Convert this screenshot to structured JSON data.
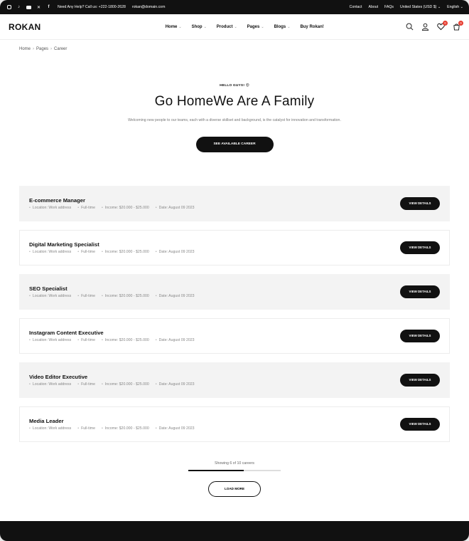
{
  "topbar": {
    "social": [
      "instagram-icon",
      "tiktok-icon",
      "youtube-icon",
      "x-icon",
      "facebook-icon"
    ],
    "help": "Need Any Help? Call us: +222-1800-2628",
    "email": "rokan@domain.com",
    "links": [
      "Contact",
      "About",
      "FAQs"
    ],
    "currency": "United States (USD $)",
    "language": "English"
  },
  "header": {
    "logo": "ROKAN",
    "nav": [
      "Home",
      "Shop",
      "Product",
      "Pages",
      "Blogs",
      "Buy Rokan!"
    ],
    "wishlist_count": "0",
    "cart_count": "0"
  },
  "breadcrumb": [
    "Home",
    "Pages",
    "Career"
  ],
  "hero": {
    "eyebrow": "HELLO GUYS! 😍",
    "title": "Go HomeWe Are A Family",
    "subtitle": "Welcoming new people to our teams, each with a diverse skillset and background, is the catalyst for innovation and transformation.",
    "cta": "SEE AVAILABLE CAREER"
  },
  "jobs": [
    {
      "title": "E-commerce Manager",
      "location": "Location: Work address",
      "type": "Full-time",
      "income": "Income: $20.000 - $25.000",
      "date": "Date: August 09 2023"
    },
    {
      "title": "Digital Marketing Specialist",
      "location": "Location: Work address",
      "type": "Full-time",
      "income": "Income: $20.000 - $25.000",
      "date": "Date: August 09 2023"
    },
    {
      "title": "SEO Specialist",
      "location": "Location: Work address",
      "type": "Full-time",
      "income": "Income: $20.000 - $25.000",
      "date": "Date: August 09 2023"
    },
    {
      "title": "Instagram Content Executive",
      "location": "Location: Work address",
      "type": "Full-time",
      "income": "Income: $20.000 - $25.000",
      "date": "Date: August 09 2023"
    },
    {
      "title": "Video Editor Executive",
      "location": "Location: Work address",
      "type": "Full-time",
      "income": "Income: $20.000 - $25.000",
      "date": "Date: August 09 2023"
    },
    {
      "title": "Media Leader",
      "location": "Location: Work address",
      "type": "Full-time",
      "income": "Income: $20.000 - $25.000",
      "date": "Date: August 09 2023"
    }
  ],
  "job_button": "VIEW DETAILS",
  "pagination": {
    "showing": "Showing 6 of 10 careers",
    "progress": 0.6,
    "load_more": "LOAD MORE"
  }
}
